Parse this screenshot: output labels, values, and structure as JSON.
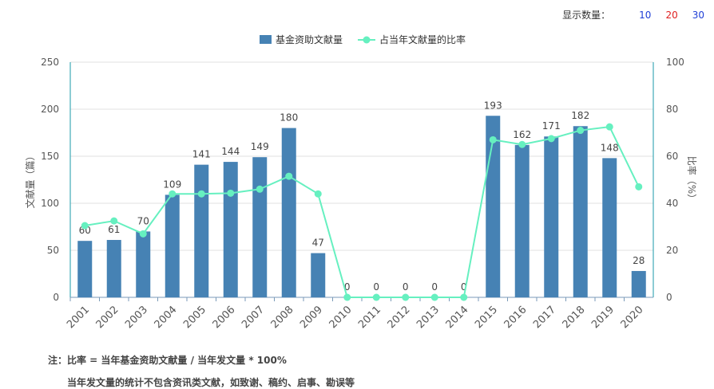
{
  "controls": {
    "display_count_label": "显示数量：",
    "options": [
      "10",
      "20",
      "30"
    ]
  },
  "notes": {
    "line1": "注：比率 = 当年基金资助文献量 / 当年发文量 * 100%",
    "line2": "当年发文量的统计不包含资讯类文献，如致谢、稿约、启事、勘误等"
  },
  "colors": {
    "bar": "#4682b4",
    "line": "#66f0c0",
    "right_axis": "#1a9aaa"
  },
  "chart_data": {
    "type": "bar",
    "categories": [
      "2001",
      "2002",
      "2003",
      "2004",
      "2005",
      "2006",
      "2007",
      "2008",
      "2009",
      "2010",
      "2011",
      "2012",
      "2013",
      "2014",
      "2015",
      "2016",
      "2017",
      "2018",
      "2019",
      "2020"
    ],
    "series": [
      {
        "name": "基金资助文献量",
        "type": "bar",
        "axis": "left",
        "values": [
          60,
          61,
          70,
          109,
          141,
          144,
          149,
          180,
          47,
          0,
          0,
          0,
          0,
          0,
          193,
          162,
          171,
          182,
          148,
          28
        ]
      },
      {
        "name": "占当年文献量的比率",
        "type": "line",
        "axis": "right",
        "values": [
          30.5,
          32.5,
          27,
          44,
          44,
          44.3,
          46,
          51.5,
          44,
          0,
          0,
          0,
          0,
          0,
          67,
          65,
          67.5,
          71,
          72.5,
          47
        ]
      }
    ],
    "ylabel_left": "文献量（篇）",
    "ylabel_right": "比率（%）",
    "ylim_left": [
      0,
      250
    ],
    "ylim_right": [
      0,
      100
    ],
    "yticks_left": [
      0,
      50,
      100,
      150,
      200,
      250
    ],
    "yticks_right": [
      0,
      20,
      40,
      60,
      80,
      100
    ],
    "legend_position": "top-center",
    "grid": true
  }
}
